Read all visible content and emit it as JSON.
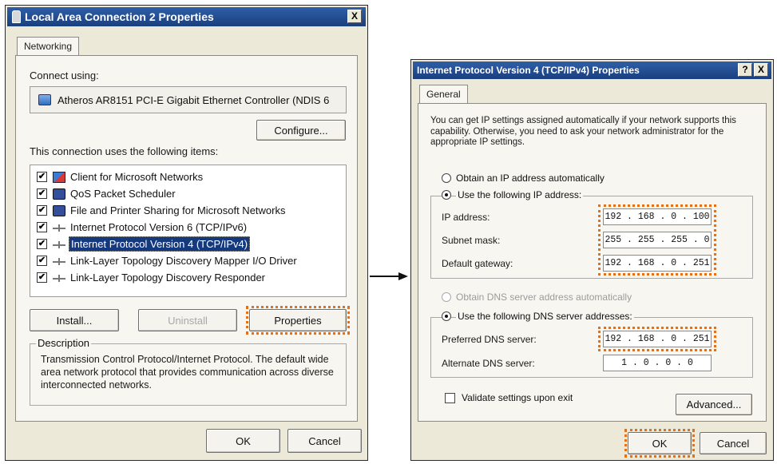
{
  "lac_dialog": {
    "title": "Local Area Connection 2 Properties",
    "close_glyph": "X",
    "tab": "Networking",
    "connect_using_label": "Connect using:",
    "adapter": "Atheros AR8151 PCI-E Gigabit Ethernet Controller (NDIS 6",
    "configure_button": "Configure...",
    "items_label": "This connection uses the following items:",
    "items": [
      {
        "label": "Client for Microsoft Networks",
        "checked": true,
        "icon": "network-client-icon"
      },
      {
        "label": "QoS Packet Scheduler",
        "checked": true,
        "icon": "network-service-icon"
      },
      {
        "label": "File and Printer Sharing for Microsoft Networks",
        "checked": true,
        "icon": "network-service-icon"
      },
      {
        "label": "Internet Protocol Version 6 (TCP/IPv6)",
        "checked": true,
        "icon": "network-protocol-icon"
      },
      {
        "label": "Internet Protocol Version 4 (TCP/IPv4)",
        "checked": true,
        "icon": "network-protocol-icon",
        "selected": true
      },
      {
        "label": "Link-Layer Topology Discovery Mapper I/O Driver",
        "checked": true,
        "icon": "network-protocol-icon"
      },
      {
        "label": "Link-Layer Topology Discovery Responder",
        "checked": true,
        "icon": "network-protocol-icon"
      }
    ],
    "install_button": "Install...",
    "uninstall_button": "Uninstall",
    "properties_button": "Properties",
    "description_title": "Description",
    "description_text": "Transmission Control Protocol/Internet Protocol. The default wide area network protocol that provides communication across diverse interconnected networks.",
    "ok_button": "OK",
    "cancel_button": "Cancel"
  },
  "ipv4_dialog": {
    "title": "Internet Protocol Version 4 (TCP/IPv4) Properties",
    "help_glyph": "?",
    "close_glyph": "X",
    "tab": "General",
    "intro_text": "You can get IP settings assigned automatically if your network supports this capability. Otherwise, you need to ask your network administrator for the appropriate IP settings.",
    "obtain_ip_auto": "Obtain an IP address automatically",
    "use_following_ip": "Use the following IP address:",
    "ip_address_label": "IP address:",
    "ip_address": "192 . 168 .  0  . 100",
    "subnet_mask_label": "Subnet mask:",
    "subnet_mask": "255 . 255 . 255 .  0",
    "default_gateway_label": "Default gateway:",
    "default_gateway": "192 . 168 .  0  . 251",
    "obtain_dns_auto": "Obtain DNS server address automatically",
    "use_following_dns": "Use the following DNS server addresses:",
    "preferred_dns_label": "Preferred DNS server:",
    "preferred_dns": "192 . 168 .  0  . 251",
    "alternate_dns_label": "Alternate DNS server:",
    "alternate_dns": "1  .  0  .  0  .  0",
    "validate_label": "Validate settings upon exit",
    "advanced_button": "Advanced...",
    "ok_button": "OK",
    "cancel_button": "Cancel"
  },
  "colors": {
    "highlight": "#e2711d",
    "titlebar": "#1a3f7e",
    "selection": "#15397f"
  }
}
